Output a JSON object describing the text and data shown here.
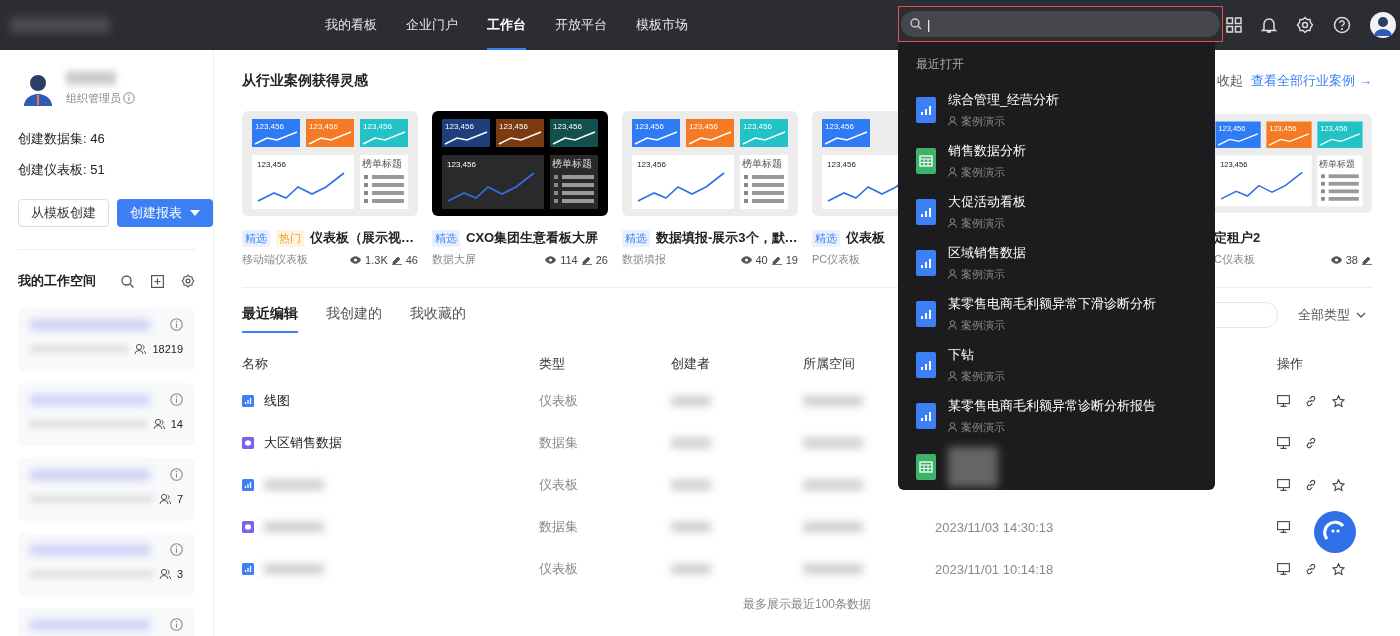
{
  "nav": {
    "items": [
      {
        "label": "我的看板",
        "selected": false
      },
      {
        "label": "企业门户",
        "selected": false
      },
      {
        "label": "工作台",
        "selected": true
      },
      {
        "label": "开放平台",
        "selected": false
      },
      {
        "label": "模板市场",
        "selected": false
      }
    ]
  },
  "search": {
    "value": "|"
  },
  "recent": {
    "title": "最近打开",
    "items": [
      {
        "kind": "chart",
        "title": "综合管理_经营分析",
        "owner": "案例演示"
      },
      {
        "kind": "sheet",
        "title": "销售数据分析",
        "owner": "案例演示"
      },
      {
        "kind": "chart",
        "title": "大促活动看板",
        "owner": "案例演示"
      },
      {
        "kind": "chart",
        "title": "区域销售数据",
        "owner": "案例演示"
      },
      {
        "kind": "chart",
        "title": "某零售电商毛利额异常下滑诊断分析",
        "owner": "案例演示"
      },
      {
        "kind": "chart",
        "title": "下钻",
        "owner": "案例演示"
      },
      {
        "kind": "chart",
        "title": "某零售电商毛利额异常诊断分析报告",
        "owner": "案例演示"
      },
      {
        "kind": "sheet"
      }
    ]
  },
  "profile": {
    "role": "组织管理员",
    "stats": [
      "创建数据集: 46",
      "创建仪表板: 51"
    ],
    "buttons": [
      "从模板创建",
      "创建报表"
    ]
  },
  "workspace": {
    "title": "我的工作空间",
    "items": [
      {
        "kind": "space",
        "members": "18219"
      },
      {
        "kind": "space",
        "members": "14"
      },
      {
        "kind": "space",
        "members": "7"
      },
      {
        "kind": "space",
        "members": "3"
      },
      {
        "kind": "space"
      }
    ]
  },
  "cases": {
    "title": "从行业案例获得灵感",
    "collapse": "收起",
    "view_all": "查看全部行业案例 →",
    "cards": [
      {
        "dark": false,
        "thumb": {
          "tiles": [
            "123,456",
            "123,456",
            "123,456"
          ],
          "main": "123,456",
          "list_title": "榜单标题"
        },
        "tags": [
          {
            "kind": "pick",
            "label": "精选"
          },
          {
            "kind": "hot",
            "label": "热门"
          }
        ],
        "title": "仪表板（展示视…",
        "type": "移动端仪表板",
        "views": "1.3K",
        "edits": "46"
      },
      {
        "dark": true,
        "thumb": {
          "tiles": [
            "123,456",
            "123,456",
            "123,456"
          ],
          "main": "123,456",
          "list_title": "榜单标题"
        },
        "tags": [
          {
            "kind": "pick",
            "label": "精选"
          }
        ],
        "title": "CXO集团生意看板大屏",
        "type": "数据大屏",
        "views": "114",
        "edits": "26"
      },
      {
        "dark": false,
        "thumb": {
          "tiles": [
            "123,456",
            "123,456",
            "123,456"
          ],
          "main": "123,456",
          "list_title": "榜单标题"
        },
        "tags": [
          {
            "kind": "pick",
            "label": "精选"
          }
        ],
        "title": "数据填报-展示3个，默…",
        "type": "数据填报",
        "views": "40",
        "edits": "19"
      },
      {
        "dark": false,
        "thumb": {
          "tiles": [
            "123,456"
          ],
          "main": "123,456"
        },
        "tags": [
          {
            "kind": "pick",
            "label": "精选"
          }
        ],
        "title": "仪表板",
        "type": "PC仪表板"
      },
      {
        "dark": false,
        "thumb": {
          "tiles": [
            "123,456",
            "123,456",
            "123,456"
          ],
          "main": "123,456",
          "list_title": "榜单标题"
        },
        "title": "定租户2",
        "type": "C仪表板",
        "views": "38"
      }
    ]
  },
  "tabs": [
    {
      "label": "最近编辑",
      "selected": true
    },
    {
      "label": "我创建的",
      "selected": false
    },
    {
      "label": "我收藏的",
      "selected": false
    }
  ],
  "filter": {
    "type": "全部类型"
  },
  "table": {
    "columns": [
      "名称",
      "类型",
      "创建者",
      "所属空间",
      "操作"
    ],
    "rows": [
      {
        "kind": "dashboard",
        "name": "线图",
        "type": "仪表板",
        "link": true,
        "star": true
      },
      {
        "kind": "dataset",
        "name": "大区销售数据",
        "type": "数据集",
        "link": true,
        "star": false
      },
      {
        "kind": "dashboard",
        "type": "仪表板",
        "link": true,
        "star": true
      },
      {
        "kind": "dataset",
        "type": "数据集",
        "time": "2023/11/03 14:30:13",
        "link": false,
        "star": false
      },
      {
        "kind": "dashboard",
        "type": "仪表板",
        "time": "2023/11/01 10:14:18",
        "link": true,
        "star": true
      }
    ]
  },
  "footer": "最多展示最近100条数据"
}
